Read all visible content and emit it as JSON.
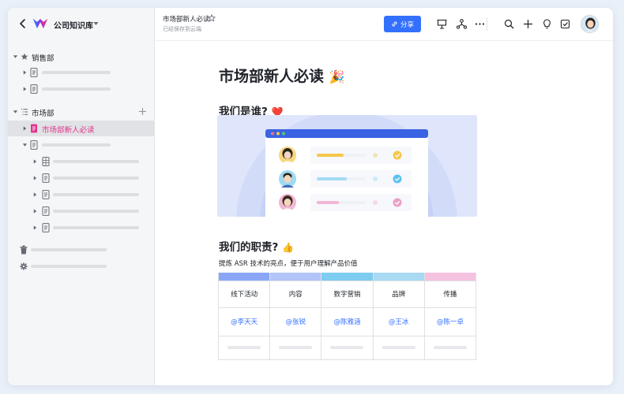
{
  "app": {
    "kb_title": "公司知识库"
  },
  "sidebar": {
    "groups": [
      {
        "label": "销售部",
        "icon": "star-icon"
      },
      {
        "label": "市场部",
        "icon": "outline-list-icon"
      }
    ],
    "active_doc": "市场部新人必读"
  },
  "header": {
    "doc_title": "市场部新人必读",
    "status": "已经保存到云端",
    "share_label": "分享"
  },
  "document": {
    "title": "市场部新人必读",
    "title_emoji": "🎉",
    "section1": "我们是谁?",
    "section1_emoji": "❤️",
    "section2": "我们的职责?",
    "section2_emoji": "👍",
    "description": "提炼 ASR 技术的亮点，便于用户理解产品价值",
    "table": {
      "header_colors": [
        "#8aa7f7",
        "#b3c4f8",
        "#7ecdf0",
        "#a9d9f3",
        "#f5c2df"
      ],
      "columns": [
        "线下活动",
        "内容",
        "数字营销",
        "品牌",
        "传播"
      ],
      "owners": [
        "@李天天",
        "@张锐",
        "@陈雅涵",
        "@王冰",
        "@陈一卓"
      ]
    }
  },
  "colors": {
    "accent": "#3370ff",
    "active_doc": "#e0338b"
  }
}
